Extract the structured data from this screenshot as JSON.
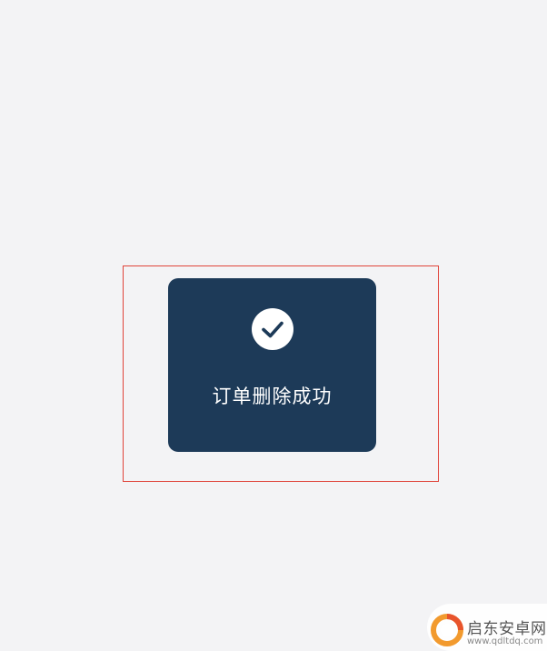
{
  "toast": {
    "message": "订单删除成功",
    "icon": "check-circle-icon"
  },
  "watermark": {
    "name": "启东安卓网",
    "url": "www.qdltdq.com"
  },
  "colors": {
    "background": "#f3f3f5",
    "toast_bg": "#1d3a58",
    "highlight_border": "#e0443a",
    "logo_orange": "#f29a2e"
  }
}
